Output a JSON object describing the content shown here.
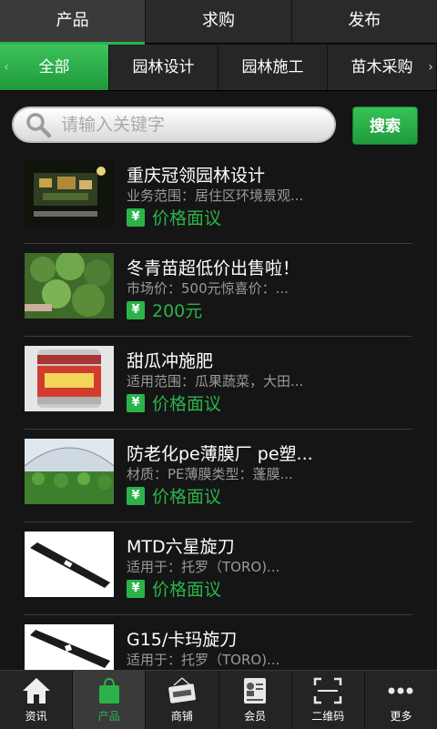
{
  "top_tabs": [
    {
      "label": "产品"
    },
    {
      "label": "求购"
    },
    {
      "label": "发布"
    }
  ],
  "categories": [
    {
      "label": "全部"
    },
    {
      "label": "园林设计"
    },
    {
      "label": "园林施工"
    },
    {
      "label": "苗木采购"
    }
  ],
  "search": {
    "placeholder": "请输入关键字",
    "button_label": "搜索"
  },
  "currency_symbol": "¥",
  "items": [
    {
      "title": "重庆冠领园林设计",
      "desc": "业务范围：居住区环境景观...",
      "price": "价格面议"
    },
    {
      "title": "冬青苗超低价出售啦！",
      "desc": "市场价：500元惊喜价：...",
      "price": "200元"
    },
    {
      "title": "甜瓜冲施肥",
      "desc": "适用范围：瓜果蔬菜，大田...",
      "price": "价格面议"
    },
    {
      "title": "防老化pe薄膜厂 pe塑...",
      "desc": "材质：PE薄膜类型：蓬膜...",
      "price": "价格面议"
    },
    {
      "title": "MTD六星旋刀",
      "desc": "适用于：托罗（TORO)...",
      "price": "价格面议"
    },
    {
      "title": "G15/卡玛旋刀",
      "desc": "适用于：托罗（TORO)...",
      "price": ""
    }
  ],
  "bottom_nav": [
    {
      "label": "资讯",
      "icon": "home-icon"
    },
    {
      "label": "产品",
      "icon": "shopping-bag-icon"
    },
    {
      "label": "商铺",
      "icon": "open-sign-icon"
    },
    {
      "label": "会员",
      "icon": "member-card-icon"
    },
    {
      "label": "二维码",
      "icon": "qr-scan-icon"
    },
    {
      "label": "更多",
      "icon": "more-dots-icon"
    }
  ],
  "colors": {
    "accent": "#2bb34a",
    "background": "#151515"
  }
}
